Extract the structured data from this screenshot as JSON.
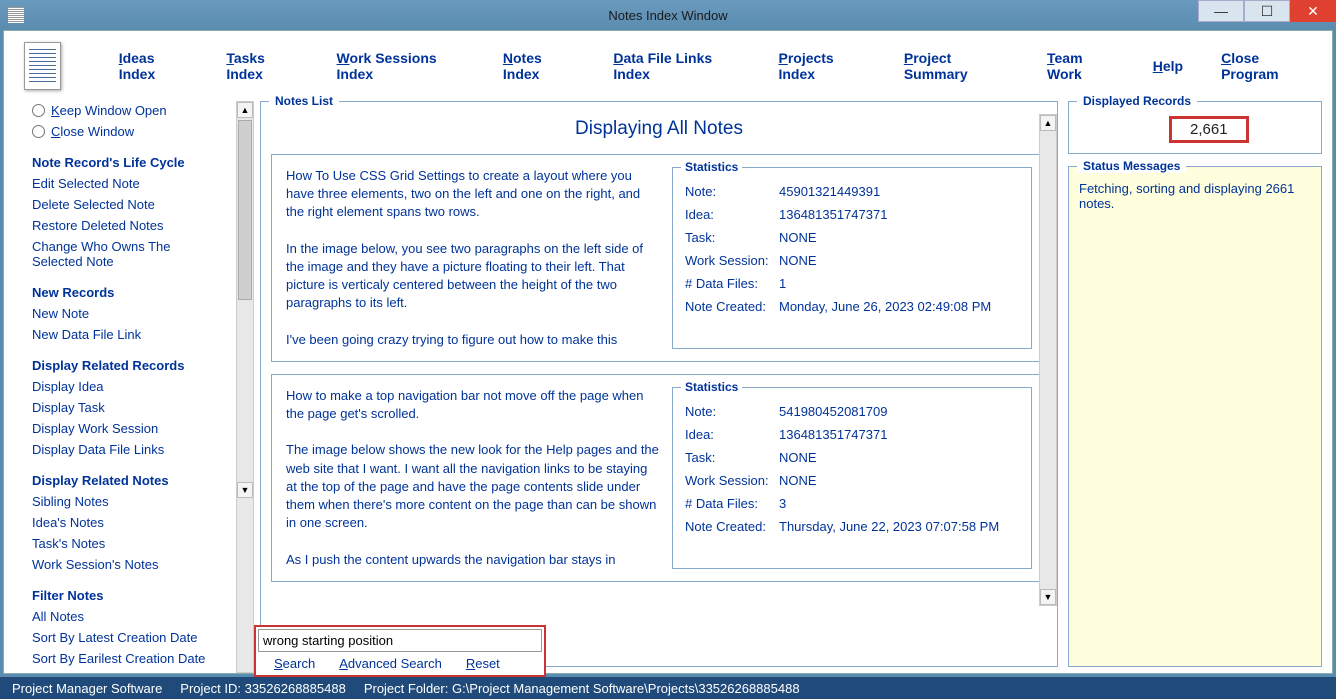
{
  "titlebar": {
    "title": "Notes Index Window"
  },
  "menu": [
    "Ideas Index",
    "Tasks Index",
    "Work Sessions Index",
    "Notes Index",
    "Data File Links Index",
    "Projects Index",
    "Project Summary",
    "Team Work",
    "Help",
    "Close Program"
  ],
  "sidebar": {
    "radio1": "Keep Window Open",
    "radio2": "Close Window",
    "sections": [
      {
        "header": "Note Record's Life Cycle",
        "links": [
          "Edit Selected Note",
          "Delete Selected Note",
          "Restore Deleted Notes",
          "Change Who Owns The Selected Note"
        ]
      },
      {
        "header": "New Records",
        "links": [
          "New Note",
          "New Data File Link"
        ]
      },
      {
        "header": "Display Related Records",
        "links": [
          "Display Idea",
          "Display Task",
          "Display Work Session",
          "Display Data File Links"
        ]
      },
      {
        "header": "Display Related Notes",
        "links": [
          "Sibling Notes",
          "Idea's Notes",
          "Task's Notes",
          "Work Session's Notes"
        ]
      },
      {
        "header": "Filter Notes",
        "links": [
          "All Notes",
          "Sort By Latest Creation Date",
          "Sort By Earilest Creation Date"
        ]
      }
    ]
  },
  "notes_list": {
    "legend": "Notes List",
    "title": "Displaying All Notes",
    "stats_legend": "Statistics",
    "stat_labels": {
      "note": "Note:",
      "idea": "Idea:",
      "task": "Task:",
      "ws": "Work Session:",
      "df": "# Data Files:",
      "created": "Note Created:"
    },
    "cards": [
      {
        "text": "How To Use CSS Grid Settings to create a layout where you have three elements, two on the left and one on the right, and the right element spans two rows.\n\nIn the image below, you see two paragraphs on the left side of the image and they have a picture floating to their left. That picture is verticaly centered between the height of the two paragraphs to its left.\n\nI've been going crazy trying to figure out how to make this",
        "stats": {
          "note": "45901321449391",
          "idea": "136481351747371",
          "task": "NONE",
          "ws": "NONE",
          "df": "1",
          "created": "Monday, June 26, 2023   02:49:08 PM"
        }
      },
      {
        "text": "How to make a top navigation bar not move off the page when the page get's scrolled.\n\nThe image below shows the new look for the Help pages and the web site that I want. I want all the navigation links to be staying at the top of the page and have the page contents slide under them when there's more content on the page than can be shown in one screen.\n\nAs I push the content upwards the navigation bar stays in",
        "stats": {
          "note": "541980452081709",
          "idea": "136481351747371",
          "task": "NONE",
          "ws": "NONE",
          "df": "3",
          "created": "Thursday, June 22, 2023   07:07:58 PM"
        }
      }
    ]
  },
  "search": {
    "value": "wrong starting position",
    "links": [
      "Search",
      "Advanced Search",
      "Reset"
    ]
  },
  "displayed": {
    "legend": "Displayed Records",
    "count": "2,661"
  },
  "status": {
    "legend": "Status Messages",
    "text": "Fetching, sorting and displaying 2661 notes."
  },
  "statusbar": {
    "app": "Project Manager Software",
    "pid": "Project ID:  33526268885488",
    "folder": "Project Folder:  G:\\Project Management Software\\Projects\\33526268885488"
  }
}
